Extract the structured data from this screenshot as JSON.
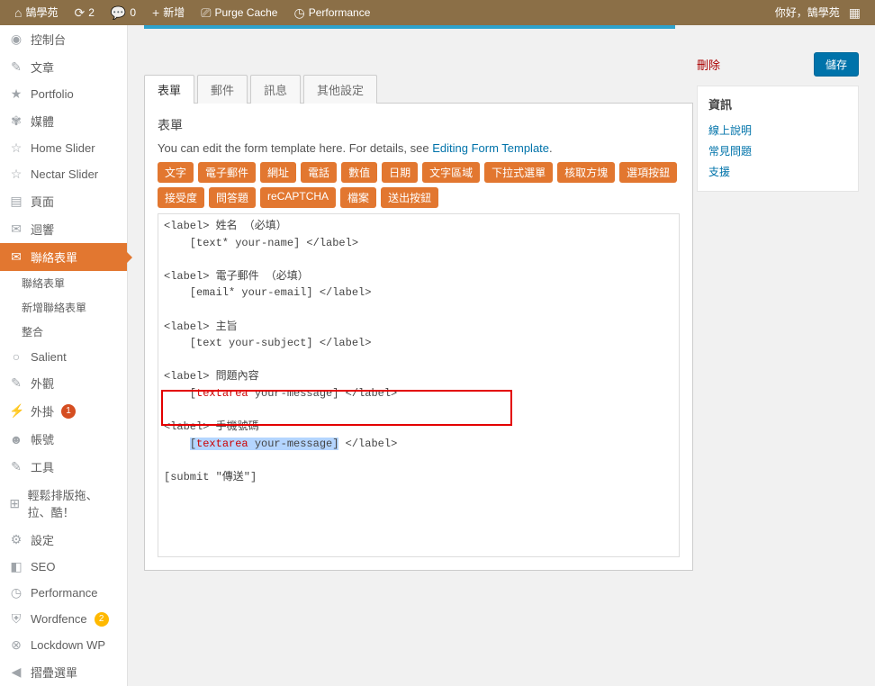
{
  "adminbar": {
    "site": "鵠學苑",
    "updates": "2",
    "comments": "0",
    "new": "新增",
    "purge": "Purge Cache",
    "perf": "Performance",
    "howdy": "你好，鵠學苑"
  },
  "sidebar": {
    "dashboard": "控制台",
    "posts": "文章",
    "portfolio": "Portfolio",
    "media": "媒體",
    "home_slider": "Home Slider",
    "nectar_slider": "Nectar Slider",
    "pages": "頁面",
    "comments": "迴響",
    "contact": "聯絡表單",
    "contact_sub1": "聯絡表單",
    "contact_sub2": "新增聯絡表單",
    "contact_sub3": "整合",
    "salient": "Salient",
    "appearance": "外觀",
    "plugins": "外掛",
    "plugins_count": "1",
    "users": "帳號",
    "tools": "工具",
    "dnd": "輕鬆排版拖、拉、酷！",
    "settings": "設定",
    "seo": "SEO",
    "performance": "Performance",
    "wordfence": "Wordfence",
    "wordfence_count": "2",
    "lockdown": "Lockdown WP",
    "collapse": "摺疊選單"
  },
  "actions": {
    "delete": "刪除",
    "save": "儲存"
  },
  "info": {
    "title": "資訊",
    "doc": "線上說明",
    "faq": "常見問題",
    "support": "支援"
  },
  "tabs": {
    "form": "表單",
    "mail": "郵件",
    "messages": "訊息",
    "additional": "其他設定"
  },
  "panel": {
    "heading": "表單",
    "desc_pre": "You can edit the form template here. For details, see ",
    "desc_link": "Editing Form Template",
    "desc_post": "."
  },
  "tags": {
    "text": "文字",
    "email": "電子郵件",
    "url": "網址",
    "tel": "電話",
    "number": "數值",
    "date": "日期",
    "textarea": "文字區域",
    "dropdown": "下拉式選單",
    "checkbox": "核取方塊",
    "radio": "選項按鈕",
    "acceptance": "接受度",
    "quiz": "問答題",
    "recaptcha": "reCAPTCHA",
    "file": "檔案",
    "submit": "送出按鈕"
  },
  "code": {
    "l1": "<label> 姓名 （必填）",
    "l2": "    [text* your-name] </label>",
    "l3": "",
    "l4": "<label> 電子郵件 （必填）",
    "l5": "    [email* your-email] </label>",
    "l6": "",
    "l7": "<label> 主旨",
    "l8": "    [text your-subject] </label>",
    "l9": "",
    "l10": "<label> 問題內容",
    "l11a": "    [",
    "l11b": "textarea",
    "l11c": " your-message] </label>",
    "l12": "",
    "l13": "<label> 手機號碼",
    "l14a": "    ",
    "l14b": "[",
    "l14c": "textarea",
    "l14d": " your-message]",
    "l14e": " </label>",
    "l15": "",
    "l16": "[submit \"傳送\"]"
  }
}
